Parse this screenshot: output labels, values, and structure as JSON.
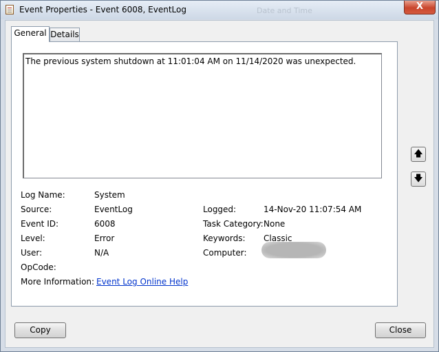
{
  "titlebar": {
    "title": "Event Properties - Event 6008, EventLog",
    "background_text": "Date and Time",
    "close_glyph": "X"
  },
  "tabs": [
    {
      "label": "General",
      "selected": true
    },
    {
      "label": "Details",
      "selected": false
    }
  ],
  "message": "The previous system shutdown at 11:01:04 AM on 11/14/2020 was unexpected.",
  "fields": {
    "log_name": {
      "label": "Log Name:",
      "value": "System"
    },
    "source": {
      "label": "Source:",
      "value": "EventLog"
    },
    "event_id": {
      "label": "Event ID:",
      "value": "6008"
    },
    "level": {
      "label": "Level:",
      "value": "Error"
    },
    "user": {
      "label": "User:",
      "value": "N/A"
    },
    "opcode": {
      "label": "OpCode:",
      "value": ""
    },
    "more_info": {
      "label": "More Information:",
      "link": "Event Log Online Help"
    },
    "logged": {
      "label": "Logged:",
      "value": "14-Nov-20 11:07:54 AM"
    },
    "task_category": {
      "label": "Task Category:",
      "value": "None"
    },
    "keywords": {
      "label": "Keywords:",
      "value": "Classic"
    },
    "computer": {
      "label": "Computer:",
      "value": ""
    }
  },
  "nav": {
    "up_icon": "arrow-up-icon",
    "down_icon": "arrow-down-icon",
    "up_glyph": "🡅",
    "down_glyph": "🡇"
  },
  "buttons": {
    "copy": "Copy",
    "close": "Close"
  }
}
